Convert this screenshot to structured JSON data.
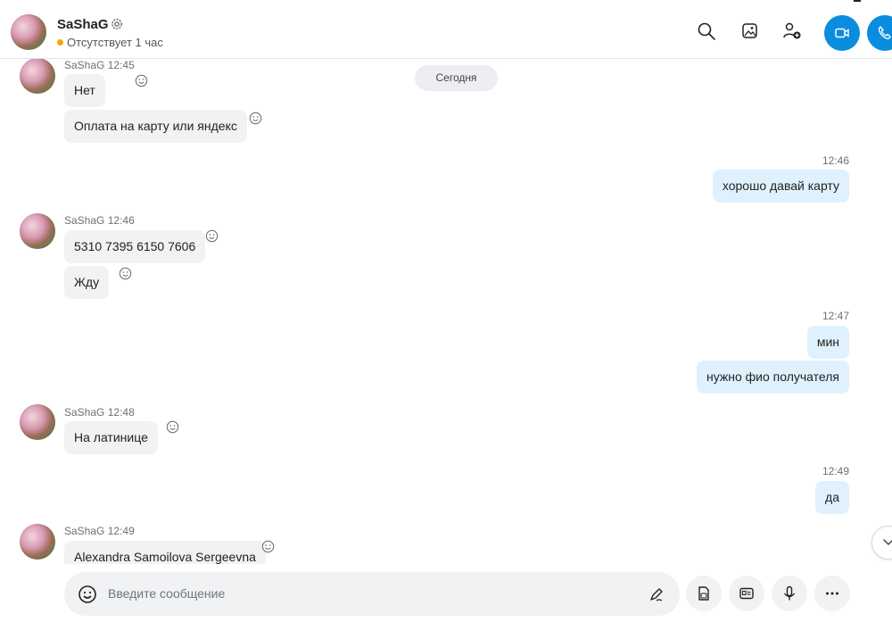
{
  "header": {
    "name": "SaShaG",
    "status": "Отсутствует 1 час",
    "icons": [
      "settings-icon",
      "search-icon",
      "gallery-icon",
      "add-people-icon",
      "video-call-icon",
      "audio-call-icon"
    ],
    "accent_color": "#0a8ddf",
    "status_color": "#f8a800"
  },
  "chat": {
    "date_divider": "Сегодня",
    "groups": [
      {
        "sender": "SaShaG",
        "time": "12:45",
        "direction": "in",
        "messages": [
          "Нет",
          "Оплата на карту или яндекс"
        ]
      },
      {
        "sender": "",
        "time": "12:46",
        "direction": "out",
        "messages": [
          "хорошо давай карту"
        ]
      },
      {
        "sender": "SaShaG",
        "time": "12:46",
        "direction": "in",
        "messages": [
          "5310 7395 6150 7606",
          "Жду"
        ]
      },
      {
        "sender": "",
        "time": "12:47",
        "direction": "out",
        "messages": [
          "мин",
          "нужно фио получателя"
        ]
      },
      {
        "sender": "SaShaG",
        "time": "12:48",
        "direction": "in",
        "messages": [
          "На латинице"
        ]
      },
      {
        "sender": "",
        "time": "12:49",
        "direction": "out",
        "messages": [
          "да"
        ]
      },
      {
        "sender": "SaShaG",
        "time": "12:49",
        "direction": "in",
        "messages": [
          "Alexandra Samoilova Sergeevna"
        ]
      }
    ]
  },
  "composer": {
    "placeholder": "Введите сообщение",
    "tools": [
      "emoji-icon",
      "pen-icon",
      "file-icon",
      "contact-card-icon",
      "microphone-icon",
      "more-icon"
    ]
  }
}
